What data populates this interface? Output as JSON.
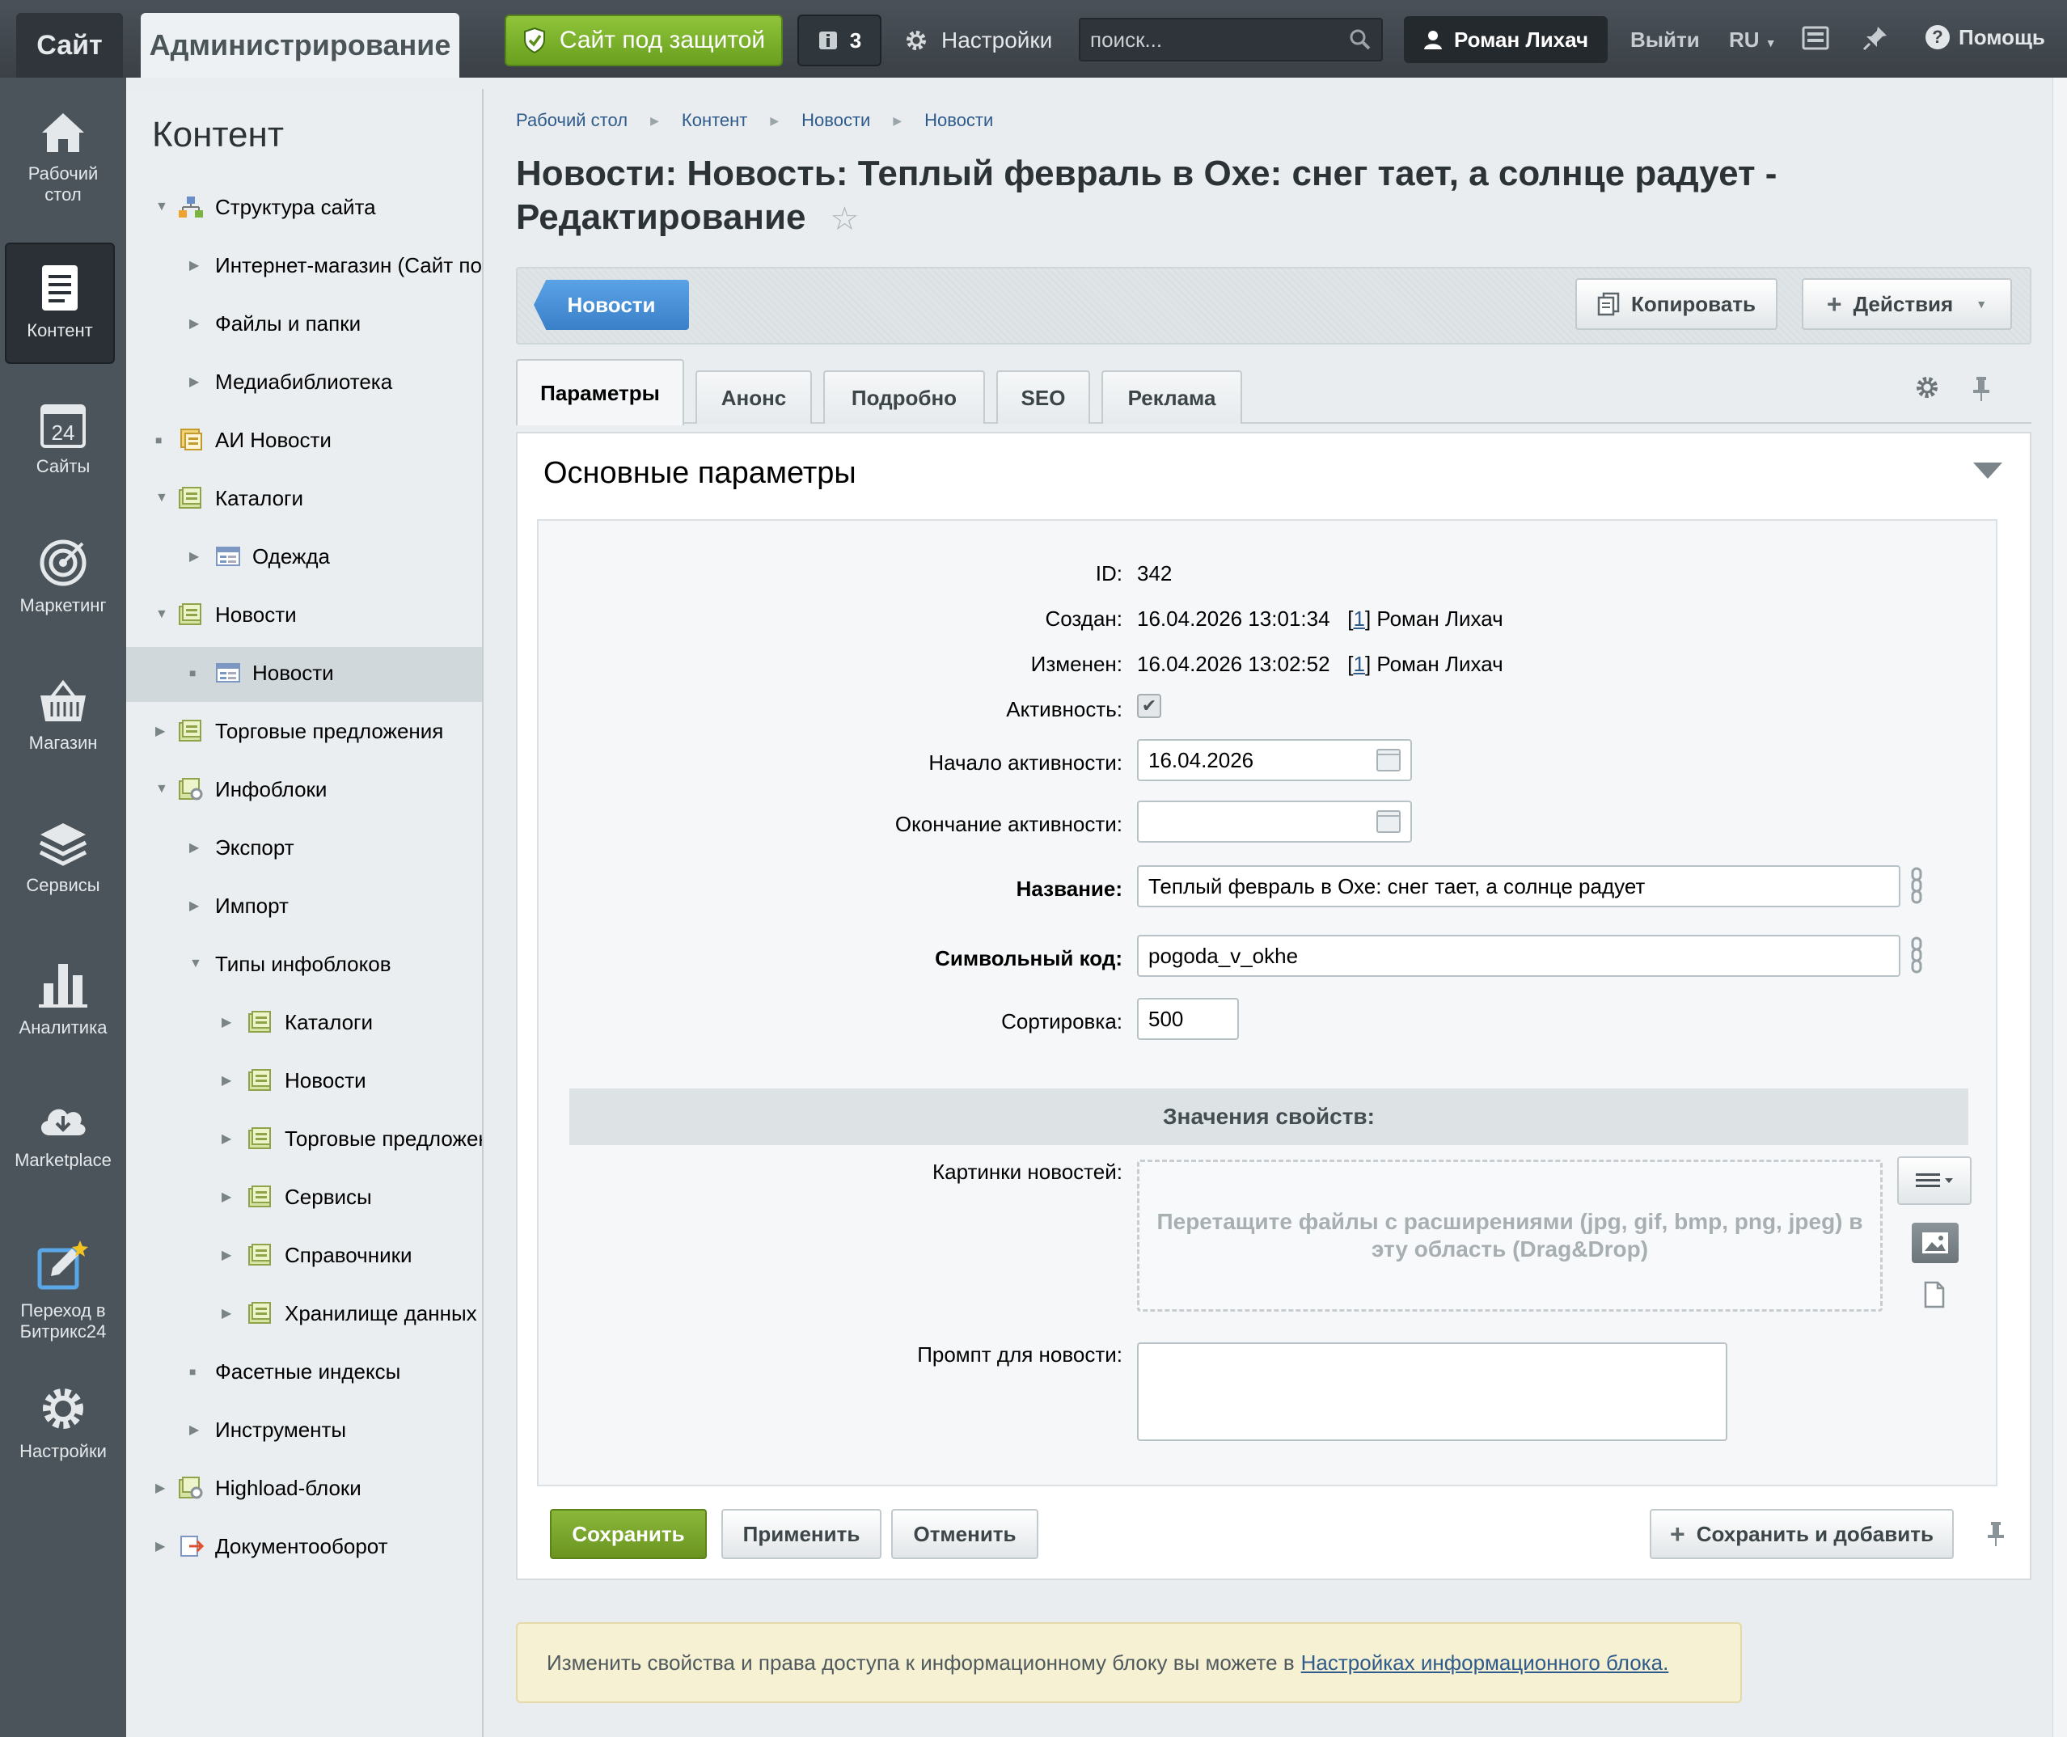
{
  "topbar": {
    "site_tab": "Сайт",
    "admin_tab": "Администрирование",
    "protection": "Сайт под защитой",
    "notifications_count": "3",
    "settings": "Настройки",
    "search_placeholder": "поиск...",
    "user": "Роман Лихач",
    "logout": "Выйти",
    "lang": "RU",
    "help": "Помощь"
  },
  "leftbar": {
    "items": [
      {
        "label": "Рабочий стол",
        "icon": "home-icon"
      },
      {
        "label": "Контент",
        "icon": "document-icon"
      },
      {
        "label": "Сайты",
        "icon": "calendar-24-icon"
      },
      {
        "label": "Маркетинг",
        "icon": "target-icon"
      },
      {
        "label": "Магазин",
        "icon": "basket-icon"
      },
      {
        "label": "Сервисы",
        "icon": "layers-icon"
      },
      {
        "label": "Аналитика",
        "icon": "bar-chart-icon"
      },
      {
        "label": "Marketplace",
        "icon": "cloud-download-icon"
      },
      {
        "label": "Переход в Битрикс24",
        "icon": "external-edit-icon"
      },
      {
        "label": "Настройки",
        "icon": "gear-icon"
      }
    ]
  },
  "tree": {
    "title": "Контент",
    "items": [
      "Структура сайта",
      "Интернет-магазин (Сайт по умолчанию)",
      "Файлы и папки",
      "Медиабиблиотека",
      "АИ Новости",
      "Каталоги",
      "Одежда",
      "Новости",
      "Новости",
      "Торговые предложения",
      "Инфоблоки",
      "Экспорт",
      "Импорт",
      "Типы инфоблоков",
      "Каталоги",
      "Новости",
      "Торговые предложения",
      "Сервисы",
      "Справочники",
      "Хранилище данных",
      "Фасетные индексы",
      "Инструменты",
      "Highload-блоки",
      "Документооборот"
    ]
  },
  "breadcrumbs": [
    "Рабочий стол",
    "Контент",
    "Новости",
    "Новости"
  ],
  "page_title": "Новости: Новость: Теплый февраль в Охе: снег тает, а солнце радует - Редактирование",
  "context": {
    "back_button": "Новости",
    "copy_button": "Копировать",
    "actions_button": "Действия"
  },
  "tabs": [
    "Параметры",
    "Анонс",
    "Подробно",
    "SEO",
    "Реклама"
  ],
  "section": {
    "title": "Основные параметры"
  },
  "form": {
    "id_label": "ID:",
    "id_value": "342",
    "created_label": "Создан:",
    "created_value": "16.04.2026 13:01:34",
    "created_user_id": "1",
    "created_user": "Роман Лихач",
    "modified_label": "Изменен:",
    "modified_value": "16.04.2026 13:02:52",
    "modified_user_id": "1",
    "modified_user": "Роман Лихач",
    "active_label": "Активность:",
    "active_from_label": "Начало активности:",
    "active_from_value": "16.04.2026",
    "active_to_label": "Окончание активности:",
    "active_to_value": "",
    "name_label": "Название:",
    "name_value": "Теплый февраль в Охе: снег тает, а солнце радует",
    "code_label": "Символьный код:",
    "code_value": "pogoda_v_okhe",
    "sort_label": "Сортировка:",
    "sort_value": "500",
    "props_header": "Значения свойств:",
    "images_label": "Картинки новостей:",
    "dropzone_text": "Перетащите файлы с расширениями (jpg, gif, bmp, png, jpeg) в эту область (Drag&Drop)",
    "prompt_label": "Промпт для новости:",
    "prompt_value": ""
  },
  "buttons": {
    "save": "Сохранить",
    "apply": "Применить",
    "cancel": "Отменить",
    "save_add": "Сохранить и добавить"
  },
  "note": {
    "text": "Изменить свойства и права доступа к информационному блоку вы можете в",
    "link": "Настройках информационного блока."
  },
  "colors": {
    "topbar": "#3f464c",
    "accent_green": "#76a82a",
    "accent_blue": "#4a90d9",
    "leftbar": "#4b545b"
  }
}
